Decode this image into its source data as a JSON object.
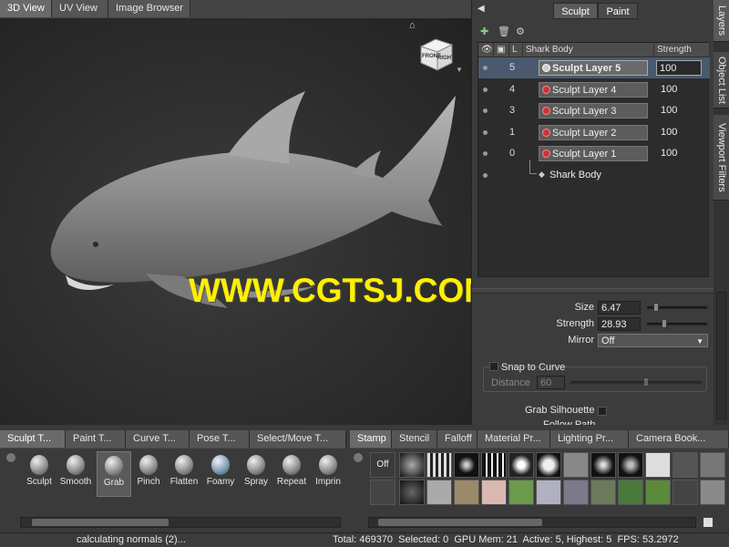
{
  "view_tabs": [
    "3D View",
    "UV View",
    "Image Browser"
  ],
  "viewcube": {
    "face_front": "FRONT",
    "face_right": "RIGHT"
  },
  "watermark": "WWW.CGTSJ.COM",
  "mode_buttons": {
    "sculpt": "Sculpt",
    "paint": "Paint"
  },
  "side_tabs": [
    "Layers",
    "Object List",
    "Viewport Filters"
  ],
  "layers": {
    "header": {
      "object": "Shark Body",
      "strength": "Strength"
    },
    "rows": [
      {
        "num": "5",
        "name": "Sculpt Layer 5",
        "strength": "100",
        "selected": true
      },
      {
        "num": "4",
        "name": "Sculpt Layer 4",
        "strength": "100",
        "selected": false
      },
      {
        "num": "3",
        "name": "Sculpt Layer 3",
        "strength": "100",
        "selected": false
      },
      {
        "num": "1",
        "name": "Sculpt Layer 2",
        "strength": "100",
        "selected": false
      },
      {
        "num": "0",
        "name": "Sculpt Layer 1",
        "strength": "100",
        "selected": false
      }
    ],
    "base": "Shark Body"
  },
  "properties": {
    "size_label": "Size",
    "size_value": "6.47",
    "strength_label": "Strength",
    "strength_value": "28.93",
    "mirror_label": "Mirror",
    "mirror_value": "Off",
    "snap_label": "Snap to Curve",
    "distance_label": "Distance",
    "distance_value": "60",
    "grab_silhouette": "Grab Silhouette",
    "follow_path": "Follow Path"
  },
  "tool_tabs": [
    "Sculpt T...",
    "Paint T...",
    "Curve T...",
    "Pose T...",
    "Select/Move T..."
  ],
  "stamp_tabs": [
    "Stamp",
    "Stencil",
    "Falloff",
    "Material Pr...",
    "Lighting Pr...",
    "Camera Book..."
  ],
  "tools": [
    {
      "label": "Sculpt",
      "active": false
    },
    {
      "label": "Smooth",
      "active": false
    },
    {
      "label": "Grab",
      "active": true
    },
    {
      "label": "Pinch",
      "active": false
    },
    {
      "label": "Flatten",
      "active": false
    },
    {
      "label": "Foamy",
      "active": false
    },
    {
      "label": "Spray",
      "active": false
    },
    {
      "label": "Repeat",
      "active": false
    },
    {
      "label": "Imprin",
      "active": false
    }
  ],
  "stamp_off": "Off",
  "status": {
    "message": "calculating normals (2)...",
    "stats": "Total: 469370  Selected: 0  GPU Mem: 21  Active: 5, Highest: 5  FPS: 53.2972"
  },
  "colors": {
    "watermark": "#ffef00",
    "selection": "#4a5a6e",
    "layer_icon": "#cc3333"
  }
}
